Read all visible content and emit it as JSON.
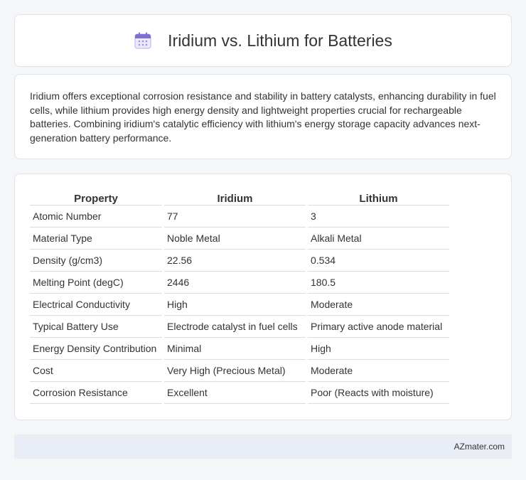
{
  "header": {
    "title": "Iridium vs. Lithium for Batteries",
    "icon": "calendar-icon"
  },
  "intro": {
    "text": "Iridium offers exceptional corrosion resistance and stability in battery catalysts, enhancing durability in fuel cells, while lithium provides high energy density and lightweight properties crucial for rechargeable batteries. Combining iridium's catalytic efficiency with lithium's energy storage capacity advances next-generation battery performance."
  },
  "table": {
    "headers": [
      "Property",
      "Iridium",
      "Lithium"
    ],
    "rows": [
      [
        "Atomic Number",
        "77",
        "3"
      ],
      [
        "Material Type",
        "Noble Metal",
        "Alkali Metal"
      ],
      [
        "Density (g/cm3)",
        "22.56",
        "0.534"
      ],
      [
        "Melting Point (degC)",
        "2446",
        "180.5"
      ],
      [
        "Electrical Conductivity",
        "High",
        "Moderate"
      ],
      [
        "Typical Battery Use",
        "Electrode catalyst in fuel cells",
        "Primary active anode material"
      ],
      [
        "Energy Density Contribution",
        "Minimal",
        "High"
      ],
      [
        "Cost",
        "Very High (Precious Metal)",
        "Moderate"
      ],
      [
        "Corrosion Resistance",
        "Excellent",
        "Poor (Reacts with moisture)"
      ]
    ]
  },
  "footer": {
    "brand": "AZmater.com"
  },
  "colors": {
    "background": "#f4f6f8",
    "card": "#ffffff",
    "footer": "#e9eef6",
    "icon_accent": "#7b6fd6"
  }
}
